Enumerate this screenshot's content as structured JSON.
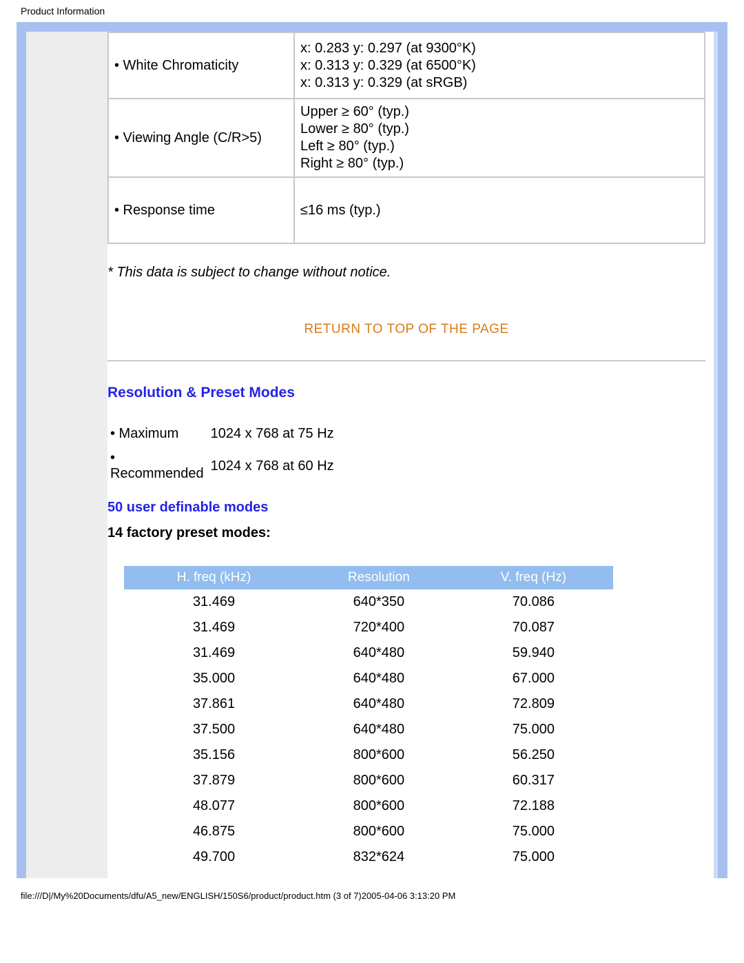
{
  "header": {
    "title": "Product Information"
  },
  "spec_rows": [
    {
      "label": "• White Chromaticity",
      "values": [
        "x: 0.283 y: 0.297 (at 9300°K)",
        "x: 0.313 y: 0.329 (at 6500°K)",
        "x: 0.313 y: 0.329 (at sRGB)"
      ],
      "tall": true
    },
    {
      "label": "• Viewing Angle (C/R>5)",
      "values": [
        "Upper ≥ 60° (typ.)",
        "Lower ≥ 80° (typ.)",
        "Left ≥ 80° (typ.)",
        "Right ≥ 80° (typ.)"
      ],
      "tall": false
    },
    {
      "label": "• Response time",
      "values": [
        "≤16 ms (typ.)"
      ],
      "short": true
    }
  ],
  "footnote": "* This data is subject to change without notice.",
  "return_link": "RETURN TO TOP OF THE PAGE",
  "section": {
    "heading": "Resolution & Preset Modes",
    "modes": [
      {
        "k": "• Maximum",
        "v": "1024 x 768 at 75 Hz"
      },
      {
        "k": "• Recommended",
        "v": "1024 x 768 at 60 Hz"
      }
    ],
    "user_definable": "50 user definable modes",
    "factory_preset_heading": "14 factory preset modes:"
  },
  "preset_table": {
    "headers": [
      "H. freq (kHz)",
      "Resolution",
      "V. freq (Hz)"
    ],
    "rows": [
      [
        "31.469",
        "640*350",
        "70.086"
      ],
      [
        "31.469",
        "720*400",
        "70.087"
      ],
      [
        "31.469",
        "640*480",
        "59.940"
      ],
      [
        "35.000",
        "640*480",
        "67.000"
      ],
      [
        "37.861",
        "640*480",
        "72.809"
      ],
      [
        "37.500",
        "640*480",
        "75.000"
      ],
      [
        "35.156",
        "800*600",
        "56.250"
      ],
      [
        "37.879",
        "800*600",
        "60.317"
      ],
      [
        "48.077",
        "800*600",
        "72.188"
      ],
      [
        "46.875",
        "800*600",
        "75.000"
      ],
      [
        "49.700",
        "832*624",
        "75.000"
      ]
    ]
  },
  "footer": {
    "path": "file:///D|/My%20Documents/dfu/A5_new/ENGLISH/150S6/product/product.htm (3 of 7)2005-04-06 3:13:20 PM"
  }
}
